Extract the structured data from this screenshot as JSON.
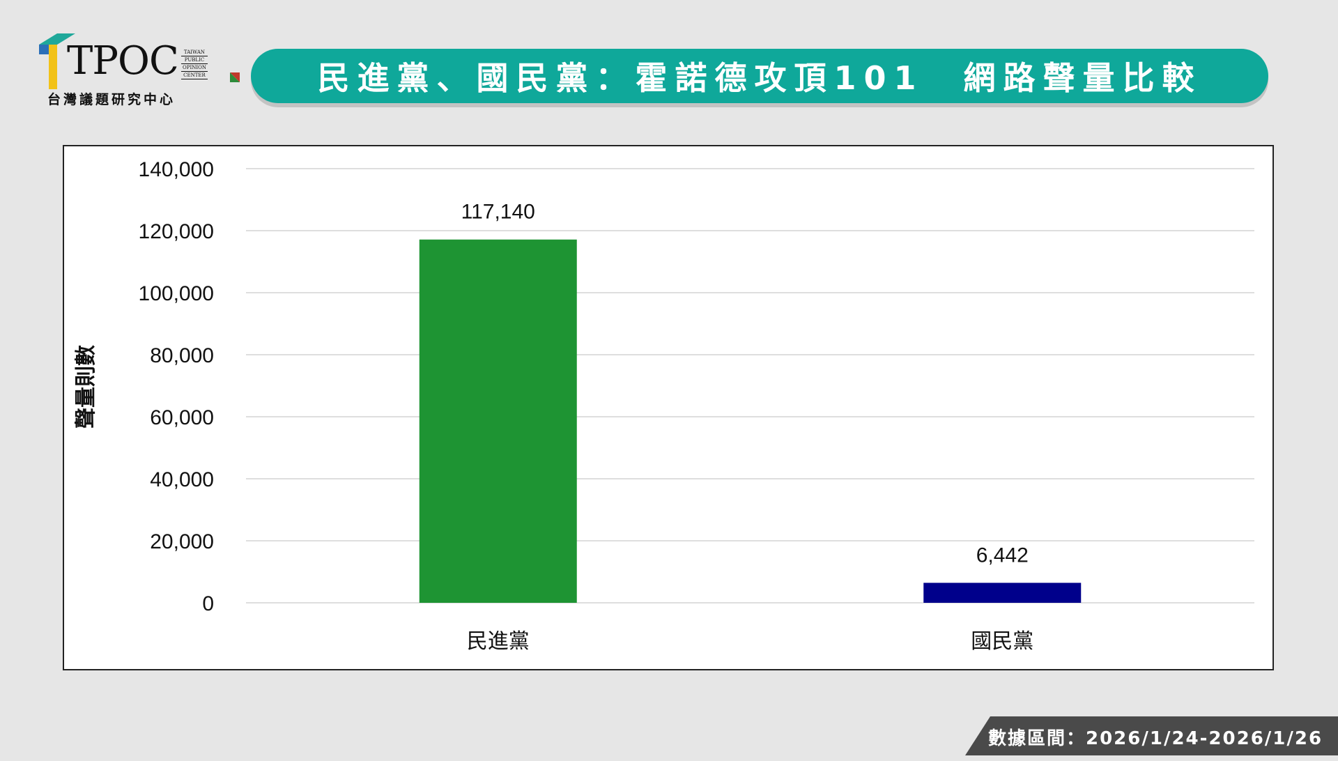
{
  "logo": {
    "wordmark": "TPOC",
    "small_lines": [
      "TAIWAN",
      "PUBLIC",
      "OPINION",
      "CENTER"
    ],
    "subtitle": "台灣議題研究中心"
  },
  "header": {
    "title": "民進黨、國民黨：霍諾德攻頂101　網路聲量比較"
  },
  "footer": {
    "date_range": "數據區間：2026/1/24-2026/1/26"
  },
  "colors": {
    "banner": "#0fa89a",
    "bar_dpp": "#1e9433",
    "bar_kmt": "#00008b",
    "footer": "#4a4a4a"
  },
  "chart_data": {
    "type": "bar",
    "title": "",
    "xlabel": "",
    "ylabel": "聲量則數",
    "ylim": [
      0,
      140000
    ],
    "yticks": [
      0,
      20000,
      40000,
      60000,
      80000,
      100000,
      120000,
      140000
    ],
    "ytick_labels": [
      "0",
      "20,000",
      "40,000",
      "60,000",
      "80,000",
      "100,000",
      "120,000",
      "140,000"
    ],
    "grid": true,
    "legend": "none",
    "categories": [
      "民進黨",
      "國民黨"
    ],
    "values": [
      117140,
      6442
    ],
    "value_labels": [
      "117,140",
      "6,442"
    ],
    "bar_colors": [
      "#1e9433",
      "#00008b"
    ]
  }
}
